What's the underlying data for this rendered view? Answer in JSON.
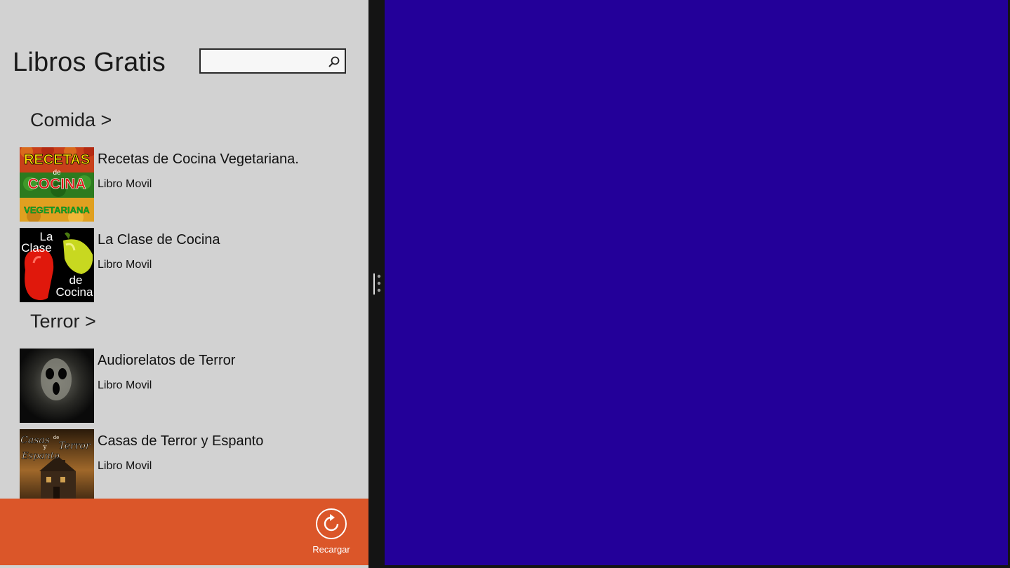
{
  "app": {
    "title": "Libros Gratis",
    "search_placeholder": "",
    "search_value": ""
  },
  "groups": [
    {
      "header": "Comida >",
      "items": [
        {
          "title": "Recetas de Cocina Vegetariana.",
          "subtitle": "Libro Movil",
          "thumb_text": [
            "RECETAS",
            "de",
            "COCINA",
            "VEGETARIANA"
          ]
        },
        {
          "title": "La Clase de Cocina",
          "subtitle": "Libro Movil",
          "thumb_text": [
            "La",
            "Clase",
            "de",
            "Cocina"
          ]
        }
      ]
    },
    {
      "header": "Terror >",
      "items": [
        {
          "title": "Audiorelatos de Terror",
          "subtitle": "Libro Movil"
        },
        {
          "title": "Casas de Terror y Espanto",
          "subtitle": "Libro Movil",
          "thumb_text": [
            "Casas",
            "de",
            "y",
            "Terror",
            "Espanto"
          ]
        }
      ]
    }
  ],
  "app_bar": {
    "reload_label": "Recargar",
    "reload_icon": "refresh-icon"
  },
  "colors": {
    "left_pane_bg": "#d2d2d2",
    "app_bar_bg": "#db5629",
    "right_pane_bg": "#230099",
    "splitter_bg": "#141414"
  }
}
